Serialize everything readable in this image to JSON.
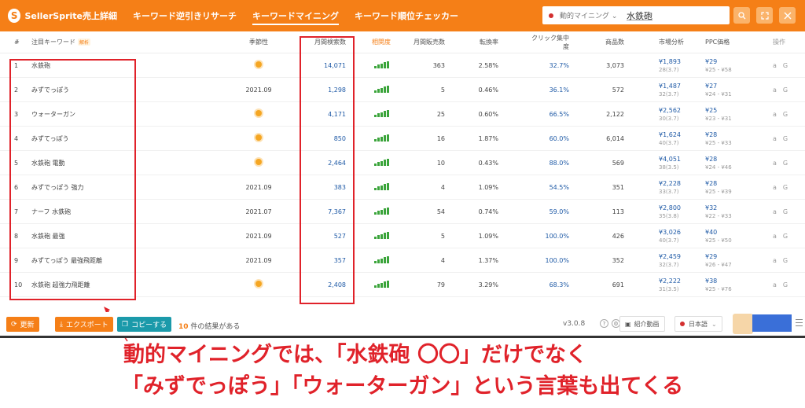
{
  "app": {
    "logo_text": "SellerSprite",
    "logo_glyph": "S"
  },
  "nav": [
    {
      "label": "売上詳細"
    },
    {
      "label": "キーワード逆引きリサーチ"
    },
    {
      "label": "キーワードマイニング",
      "active": true
    },
    {
      "label": "キーワード順位チェッカー"
    }
  ],
  "search": {
    "market": "動的マイニング ⌄",
    "value": "水鉄砲"
  },
  "header_icons": [
    "search-icon",
    "expand-icon",
    "close-icon"
  ],
  "table": {
    "headers": {
      "num": "#",
      "kw": "注目キーワード",
      "kw_hint": "解析",
      "season": "季節性",
      "search": "月間検索数",
      "rel": "相関度",
      "sales": "月間販売数",
      "conv": "転換率",
      "click": "クリック集中度",
      "prod": "商品数",
      "mkt": "市場分析",
      "ppc": "PPC価格",
      "ops": "操作"
    },
    "rows": [
      {
        "num": "1",
        "kw": "水鉄砲",
        "season": "",
        "search": "14,071",
        "sales": "363",
        "conv": "2.58%",
        "click": "32.7%",
        "prod": "3,073",
        "mkt_price": "¥1,893",
        "mkt_sub": "28(3.7)",
        "ppc_price": "¥29",
        "ppc_range": "¥25 - ¥58"
      },
      {
        "num": "2",
        "kw": "みずでっぽう",
        "season": "2021.09",
        "search": "1,298",
        "sales": "5",
        "conv": "0.46%",
        "click": "36.1%",
        "prod": "572",
        "mkt_price": "¥1,487",
        "mkt_sub": "32(3.7)",
        "ppc_price": "¥27",
        "ppc_range": "¥24 - ¥31"
      },
      {
        "num": "3",
        "kw": "ウォーターガン",
        "season": "",
        "search": "4,171",
        "sales": "25",
        "conv": "0.60%",
        "click": "66.5%",
        "prod": "2,122",
        "mkt_price": "¥2,562",
        "mkt_sub": "30(3.7)",
        "ppc_price": "¥25",
        "ppc_range": "¥23 - ¥31"
      },
      {
        "num": "4",
        "kw": "みずてっぽう",
        "season": "",
        "search": "850",
        "sales": "16",
        "conv": "1.87%",
        "click": "60.0%",
        "prod": "6,014",
        "mkt_price": "¥1,624",
        "mkt_sub": "40(3.7)",
        "ppc_price": "¥28",
        "ppc_range": "¥25 - ¥33"
      },
      {
        "num": "5",
        "kw": "水鉄砲 電動",
        "season": "",
        "search": "2,464",
        "sales": "10",
        "conv": "0.43%",
        "click": "88.0%",
        "prod": "569",
        "mkt_price": "¥4,051",
        "mkt_sub": "38(3.5)",
        "ppc_price": "¥28",
        "ppc_range": "¥24 - ¥46"
      },
      {
        "num": "6",
        "kw": "みずでっぽう 強力",
        "season": "2021.09",
        "search": "383",
        "sales": "4",
        "conv": "1.09%",
        "click": "54.5%",
        "prod": "351",
        "mkt_price": "¥2,228",
        "mkt_sub": "33(3.7)",
        "ppc_price": "¥28",
        "ppc_range": "¥25 - ¥39"
      },
      {
        "num": "7",
        "kw": "ナーフ 水鉄砲",
        "season": "2021.07",
        "search": "7,367",
        "sales": "54",
        "conv": "0.74%",
        "click": "59.0%",
        "prod": "113",
        "mkt_price": "¥2,800",
        "mkt_sub": "35(3.8)",
        "ppc_price": "¥32",
        "ppc_range": "¥22 - ¥33"
      },
      {
        "num": "8",
        "kw": "水鉄砲 最強",
        "season": "2021.09",
        "search": "527",
        "sales": "5",
        "conv": "1.09%",
        "click": "100.0%",
        "prod": "426",
        "mkt_price": "¥3,026",
        "mkt_sub": "40(3.7)",
        "ppc_price": "¥40",
        "ppc_range": "¥25 - ¥50"
      },
      {
        "num": "9",
        "kw": "みずてっぽう 最強飛距離",
        "season": "2021.09",
        "search": "357",
        "sales": "4",
        "conv": "1.37%",
        "click": "100.0%",
        "prod": "352",
        "mkt_price": "¥2,459",
        "mkt_sub": "32(3.7)",
        "ppc_price": "¥29",
        "ppc_range": "¥26 - ¥47"
      },
      {
        "num": "10",
        "kw": "水鉄砲 超強力飛距離",
        "season": "",
        "search": "2,408",
        "sales": "79",
        "conv": "3.29%",
        "click": "68.3%",
        "prod": "691",
        "mkt_price": "¥2,222",
        "mkt_sub": "31(3.5)",
        "ppc_price": "¥38",
        "ppc_range": "¥25 - ¥76"
      }
    ],
    "ops_a": "a",
    "ops_g": "G"
  },
  "footer": {
    "refresh": "更新",
    "export": "エクスポート",
    "copy": "コピーする",
    "result_count": "10",
    "result_suffix": " 件の結果がある",
    "version": "v3.0.8",
    "video": "紹介動画",
    "language": "日本語"
  },
  "colors": {
    "brand": "#f57f17",
    "annotation": "#e0222a",
    "link": "#1f5aa6",
    "bars": "#3aa43a"
  },
  "caption": {
    "line1": "動的マイニングでは、「水鉄砲 〇〇」だけでなく",
    "line2": "「みずでっぽう」「ウォーターガン」という言葉も出てくる"
  }
}
